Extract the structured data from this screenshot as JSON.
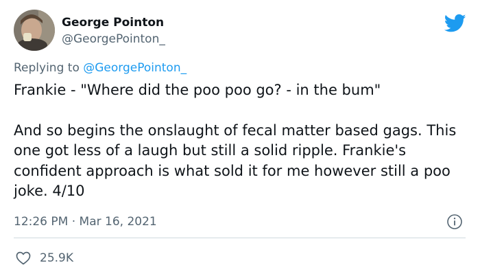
{
  "author": {
    "name": "George Pointon",
    "handle": "@GeorgePointon_",
    "avatar": "profile-photo"
  },
  "reply": {
    "prefix": "Replying to",
    "mention": "@GeorgePointon_"
  },
  "tweet": {
    "paragraph_1": "Frankie - \"Where did the poo poo go? - in the bum\"",
    "paragraph_2": "And so begins the onslaught of fecal matter based gags. This one got less of a laugh but still a solid ripple. Frankie's confident approach is what sold it for me however still a poo joke. 4/10"
  },
  "meta": {
    "time": "12:26 PM",
    "separator": " · ",
    "date": "Mar 16, 2021"
  },
  "engagement": {
    "likes": "25.9K"
  },
  "icons": {
    "brand": "twitter-bird-icon",
    "info": "info-icon",
    "like": "heart-icon"
  },
  "colors": {
    "brand": "#1d9bf0",
    "text": "#0f1419",
    "secondary": "#536471",
    "divider": "#cfd9de"
  }
}
